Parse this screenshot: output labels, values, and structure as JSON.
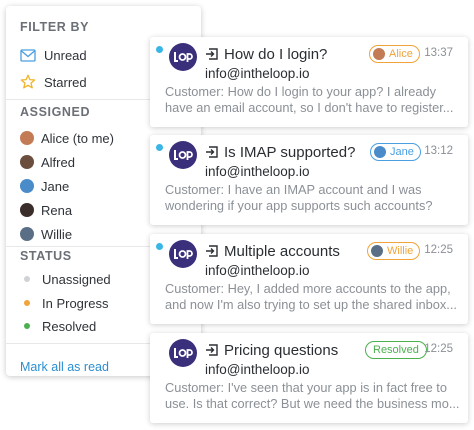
{
  "filter": {
    "filter_by_title": "FILTER BY",
    "unread_label": "Unread",
    "starred_label": "Starred",
    "assigned_title": "ASSIGNED",
    "assignees": [
      {
        "label": "Alice (to me)",
        "color": "#c27b55"
      },
      {
        "label": "Alfred",
        "color": "#6b4e3d"
      },
      {
        "label": "Jane",
        "color": "#4a8bc9"
      },
      {
        "label": "Rena",
        "color": "#3b2d2a"
      },
      {
        "label": "Willie",
        "color": "#5a6f86"
      }
    ],
    "status_title": "STATUS",
    "statuses": [
      {
        "label": "Unassigned",
        "color": "#cfd2d6"
      },
      {
        "label": "In Progress",
        "color": "#f0a43a"
      },
      {
        "label": "Resolved",
        "color": "#4cb04f"
      }
    ],
    "mark_all_label": "Mark all as read"
  },
  "cards": [
    {
      "subject": "How do I login?",
      "sender": "info@intheloop.io",
      "preview_line1": "Customer: How do I login to your app? I already",
      "preview_line2": "have an email account, so I don't have to register...",
      "pill_label": "Alice",
      "time": "13:37",
      "unread": true
    },
    {
      "subject": "Is IMAP supported?",
      "sender": "info@intheloop.io",
      "preview_line1": "Customer: I have an IMAP account and I was",
      "preview_line2": "wondering if your app supports such accounts?",
      "pill_label": "Jane",
      "time": "13:12",
      "unread": true
    },
    {
      "subject": "Multiple accounts",
      "sender": "info@intheloop.io",
      "preview_line1": "Customer: Hey, I added more accounts to the app,",
      "preview_line2": "and now I'm also trying to set up the shared inbox...",
      "pill_label": "Willie",
      "time": "12:25",
      "unread": true
    },
    {
      "subject": "Pricing questions",
      "sender": "info@intheloop.io",
      "preview_line1": "Customer: I've seen that your app is in fact free to",
      "preview_line2": "use. Is that correct? But we need the business mo...",
      "pill_label": "Resolved",
      "time": "12:25",
      "unread": false
    }
  ],
  "colors": {
    "accent_orange": "#f0a43a",
    "accent_blue": "#4a9fe0",
    "accent_green": "#4cb04f",
    "logo_purple": "#3a2f7a",
    "unread_dot": "#39b6e6",
    "link_blue": "#2b8fd0"
  }
}
